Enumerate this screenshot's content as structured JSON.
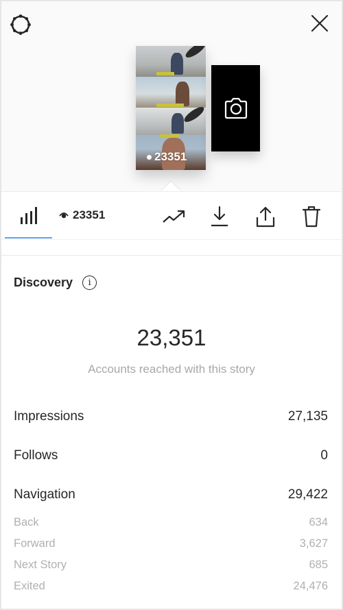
{
  "header": {
    "settings_icon": "gear-icon",
    "close_icon": "close-icon",
    "story_thumbnail": {
      "view_count": "23351",
      "icon": "eye-icon"
    },
    "add_story_card": {
      "icon": "camera-icon"
    }
  },
  "toolbar": {
    "active_tab_icon": "bar-chart-icon",
    "view_count": "23351",
    "view_icon": "eye-icon",
    "actions": [
      {
        "name": "promote",
        "icon": "trending-up-icon"
      },
      {
        "name": "download",
        "icon": "download-icon"
      },
      {
        "name": "share",
        "icon": "share-icon"
      },
      {
        "name": "delete",
        "icon": "trash-icon"
      }
    ],
    "accent_color": "#5ea1f0"
  },
  "discovery": {
    "title": "Discovery",
    "info_icon": "i",
    "reach_value": "23,351",
    "reach_caption": "Accounts reached with this story",
    "metrics": [
      {
        "label": "Impressions",
        "value": "27,135"
      },
      {
        "label": "Follows",
        "value": "0"
      },
      {
        "label": "Navigation",
        "value": "29,422"
      }
    ],
    "navigation_breakdown": [
      {
        "label": "Back",
        "value": "634"
      },
      {
        "label": "Forward",
        "value": "3,627"
      },
      {
        "label": "Next Story",
        "value": "685"
      },
      {
        "label": "Exited",
        "value": "24,476"
      }
    ]
  }
}
